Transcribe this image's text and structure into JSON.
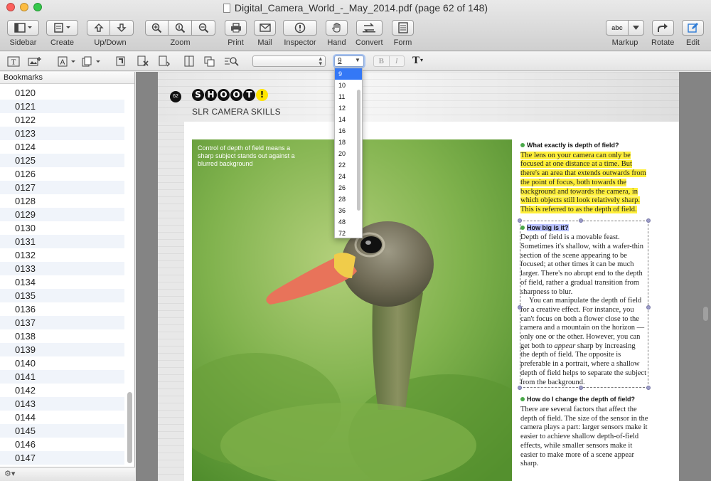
{
  "window": {
    "title": "Digital_Camera_World_-_May_2014.pdf (page 62 of 148)"
  },
  "toolbar": {
    "sidebar_label": "Sidebar",
    "create_label": "Create",
    "updown_label": "Up/Down",
    "zoom_label": "Zoom",
    "print_label": "Print",
    "mail_label": "Mail",
    "inspector_label": "Inspector",
    "hand_label": "Hand",
    "convert_label": "Convert",
    "form_label": "Form",
    "markup_label": "Markup",
    "markup_btn_text": "abc",
    "rotate_label": "Rotate",
    "edit_label": "Edit"
  },
  "format_bar": {
    "font_name": "",
    "font_size": "9",
    "bold": "B",
    "italic": "I",
    "text_tool": "T"
  },
  "font_size_menu": {
    "options": [
      "9",
      "10",
      "11",
      "12",
      "14",
      "16",
      "18",
      "20",
      "22",
      "24",
      "26",
      "28",
      "36",
      "48",
      "72"
    ],
    "selected": "9"
  },
  "sidebar": {
    "header": "Bookmarks",
    "items": [
      "0120",
      "0121",
      "0122",
      "0123",
      "0124",
      "0125",
      "0126",
      "0127",
      "0128",
      "0129",
      "0130",
      "0131",
      "0132",
      "0133",
      "0134",
      "0135",
      "0136",
      "0137",
      "0138",
      "0139",
      "0140",
      "0141",
      "0142",
      "0143",
      "0144",
      "0145",
      "0146",
      "0147"
    ],
    "footer_icon": "gear-icon"
  },
  "page": {
    "page_number": "62",
    "brand_letters": [
      "S",
      "H",
      "O",
      "O",
      "T",
      "!"
    ],
    "section": "SLR CAMERA SKILLS",
    "photo_caption": "Control of depth of field means a sharp subject stands out against a blurred background",
    "q1": "What exactly is depth of field?",
    "a1": "The lens on your camera can only be focused at one distance at a time. But there's an area that extends outwards from the point of focus, both towards the background and towards the camera, in which objects still look relatively sharp. This is referred to as the depth of field.",
    "q2": "How big is it?",
    "a2_p1": "Depth of field is a movable feast. Sometimes it's shallow, with a wafer-thin section of the scene appearing to be focused; at other times it can be much larger. There's no abrupt end to the depth of field, rather a gradual transition from sharpness to blur.",
    "a2_p2_before": "You can manipulate the depth of field for a creative effect. For instance, you can't focus on both a flower close to the camera and a mountain on the horizon — only one or the other. However, you can get both to ",
    "a2_p2_em": "appear",
    "a2_p2_after": " sharp by increasing the depth of field. The opposite is preferable in a portrait, where a shallow depth of field helps to separate the subject from the background.",
    "q3": "How do I change the depth of field?",
    "a3": "There are several factors that affect the depth of field. The size of the sensor in the camera plays a part: larger sensors make it easier to achieve shallow depth-of-field effects, while smaller sensors make it easier to make more of a scene appear sharp."
  },
  "colors": {
    "highlight_yellow": "#ffef3a",
    "highlight_blue": "#b9c2ff",
    "menu_selection": "#3478f6"
  }
}
